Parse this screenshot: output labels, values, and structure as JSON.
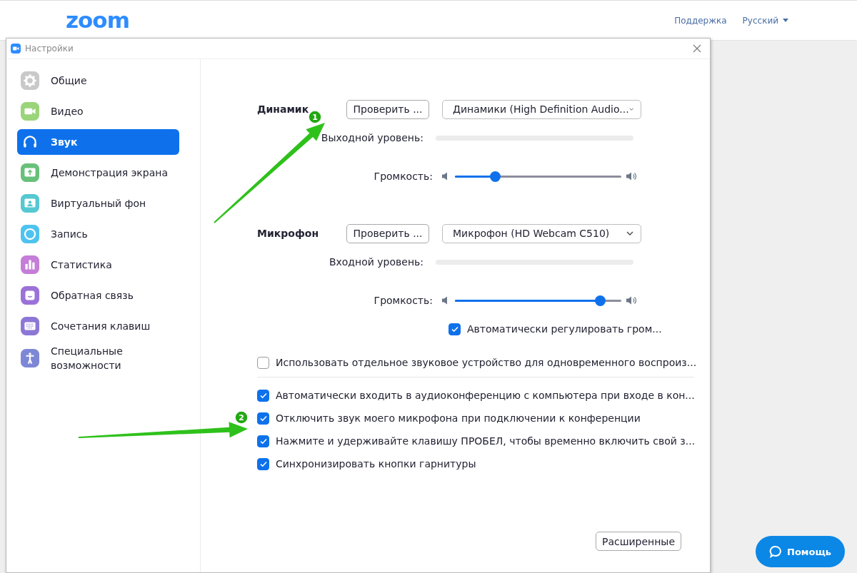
{
  "page_header": {
    "logo": "zoom",
    "links": [
      {
        "label": "Поддержка",
        "kind": "link"
      },
      {
        "label": "Русский",
        "kind": "dropdown"
      }
    ]
  },
  "window": {
    "title": "Настройки"
  },
  "sidebar": {
    "items": [
      {
        "label": "Общие",
        "color": "#c9c9c9",
        "selected": false
      },
      {
        "label": "Видео",
        "color": "#9bd47a",
        "selected": false
      },
      {
        "label": "Звук",
        "selected": true
      },
      {
        "label": "Демонстрация экрана",
        "color": "#68c07a",
        "selected": false
      },
      {
        "label": "Виртуальный фон",
        "color": "#56c8d2",
        "selected": false
      },
      {
        "label": "Запись",
        "color": "#4fc3ef",
        "selected": false
      },
      {
        "label": "Статистика",
        "color": "#c47ed8",
        "selected": false
      },
      {
        "label": "Обратная связь",
        "color": "#9b72d8",
        "selected": false
      },
      {
        "label": "Сочетания клавиш",
        "color": "#8d77d6",
        "selected": false
      },
      {
        "label": "Специальные возможности",
        "color": "#7d87d6",
        "selected": false
      }
    ]
  },
  "speaker": {
    "title": "Динамик",
    "test_button": "Проверить ...",
    "device": "Динамики (High Definition Audio...",
    "meter_label": "Выходной уровень:",
    "volume_label": "Громкость:",
    "volume": {
      "level": 0.24
    }
  },
  "microphone": {
    "title": "Микрофон",
    "test_button": "Проверить ...",
    "device": "Микрофон (HD Webcam C510)",
    "meter_label": "Входной уровень:",
    "volume_label": "Громкость:",
    "volume": {
      "level": 0.87
    },
    "auto_adjust": {
      "label": "Автоматически регулировать гром...",
      "checked": true
    }
  },
  "separate_device": {
    "label": "Использовать отдельное звуковое устройство для одновременного воспроиз...",
    "checked": false
  },
  "options": [
    {
      "label": "Автоматически входить в аудиоконференцию с компьютера при входе в кон...",
      "checked": true
    },
    {
      "label": "Отключить звук моего микрофона при подключении к конференции",
      "checked": true
    },
    {
      "label": "Нажмите и удерживайте клавишу ПРОБЕЛ, чтобы временно включить свой з...",
      "checked": true
    },
    {
      "label": "Синхронизировать кнопки гарнитуры",
      "checked": true
    }
  ],
  "advanced_button": "Расширенные",
  "help_button": "Помощь",
  "annotations": [
    {
      "number": "1"
    },
    {
      "number": "2"
    }
  ]
}
